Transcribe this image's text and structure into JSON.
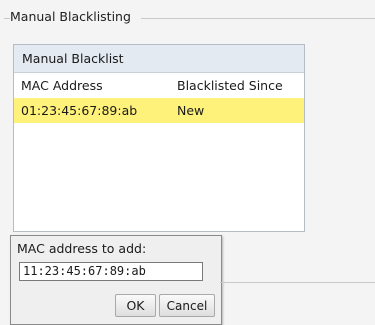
{
  "section": {
    "legend": "Manual Blacklisting"
  },
  "blacklist": {
    "title": "Manual Blacklist",
    "columns": [
      "MAC Address",
      "Blacklisted Since"
    ],
    "rows": [
      {
        "mac": "01:23:45:67:89:ab",
        "since": "New",
        "selected": true
      }
    ]
  },
  "add_dialog": {
    "label": "MAC address to add:",
    "input_value": "11:23:45:67:89:ab",
    "ok_label": "OK",
    "cancel_label": "Cancel"
  },
  "colors": {
    "selected_row": "#fff27a",
    "header_bg": "#e3eaf1"
  }
}
